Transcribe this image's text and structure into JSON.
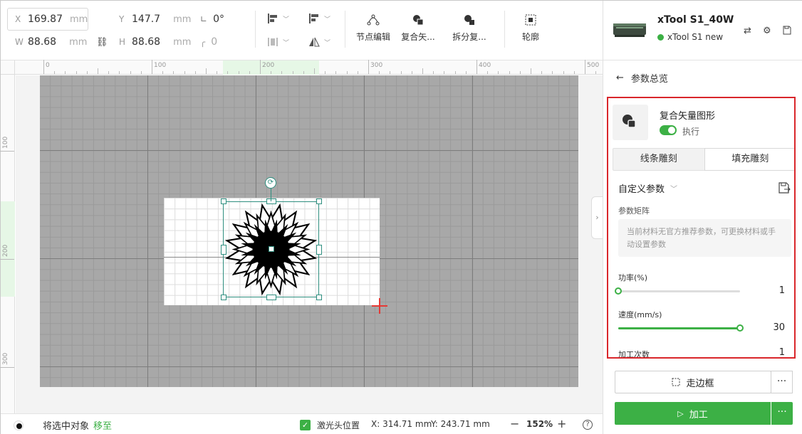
{
  "toolbar": {
    "x": {
      "label": "X",
      "value": "169.87",
      "unit": "mm"
    },
    "y": {
      "label": "Y",
      "value": "147.7",
      "unit": "mm"
    },
    "w": {
      "label": "W",
      "value": "88.68",
      "unit": "mm"
    },
    "h": {
      "label": "H",
      "value": "88.68",
      "unit": "mm"
    },
    "angle": "0°",
    "corner": "0",
    "tools": {
      "node_edit": "节点编辑",
      "compound": "复合矢...",
      "split": "拆分复...",
      "outline": "轮廓"
    }
  },
  "ruler": {
    "top": [
      "0",
      "100",
      "200",
      "300",
      "400",
      "500"
    ],
    "left": [
      "100",
      "200",
      "300"
    ]
  },
  "status": {
    "move_text": "将选中对象",
    "move_link": "移至",
    "laser_label": "激光头位置",
    "x_coord": "X: 314.71 mm",
    "y_coord": "Y: 243.71 mm",
    "zoom": "152%",
    "zoom_out": "−",
    "zoom_in": "+",
    "help": "?"
  },
  "device": {
    "name": "xTool S1_40W",
    "status": "xTool S1 new",
    "status_color": "#3cb045"
  },
  "panel": {
    "back_label": "参数总览",
    "op_title": "复合矢量图形",
    "exec_label": "执行",
    "tabs": [
      "线条雕刻",
      "填充雕刻"
    ],
    "active_tab": 1,
    "custom_params": "自定义参数",
    "matrix_label": "参数矩阵",
    "matrix_text": "当前材料无官方推荐参数，可更换材料或手动设置参数",
    "power": {
      "label": "功率(%)",
      "value": "1",
      "fraction": 0.0
    },
    "speed": {
      "label": "速度(mm/s)",
      "value": "30",
      "fraction": 1.0
    },
    "passes": {
      "label": "加工次数",
      "value": "1"
    },
    "frame_button": "走边框",
    "process_button": "加工",
    "more": "···"
  },
  "colors": {
    "accent": "#3cb045",
    "highlight_border": "#d9262b",
    "selection": "#2f8f80"
  }
}
